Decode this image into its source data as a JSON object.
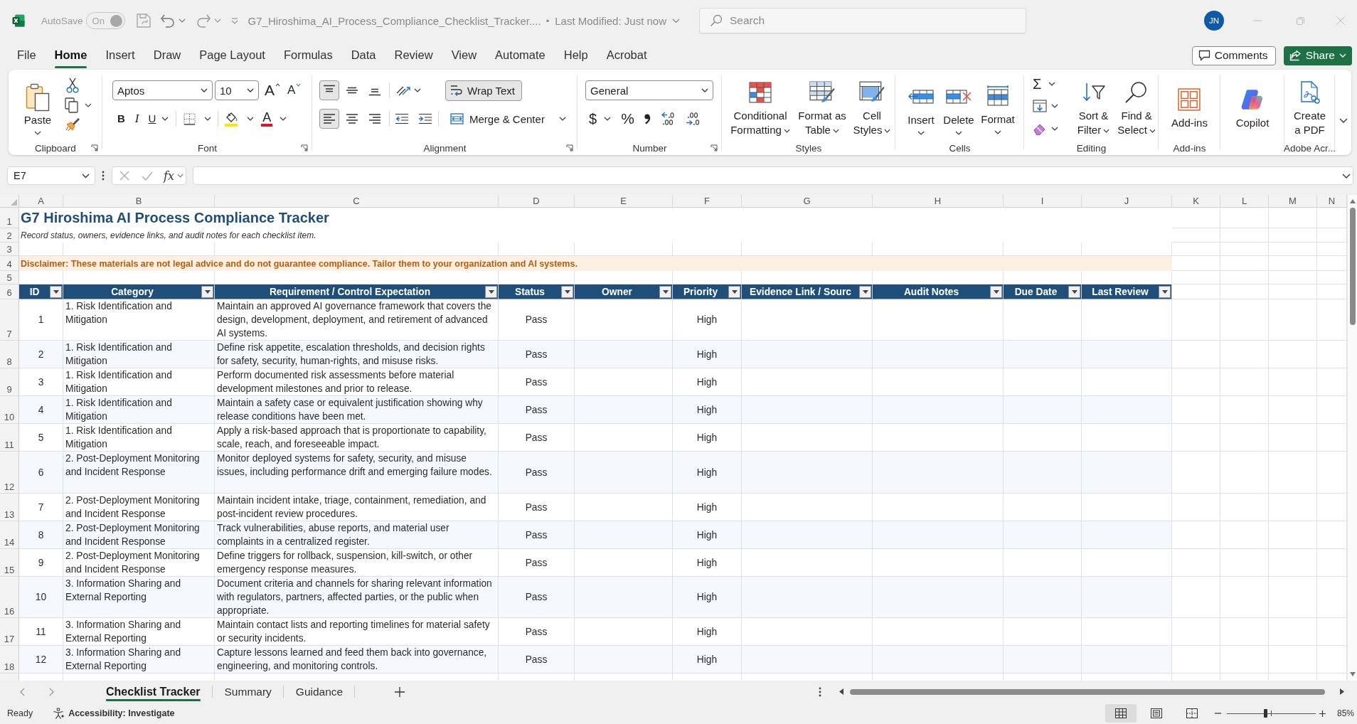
{
  "title_bar": {
    "autosave": {
      "label": "AutoSave",
      "toggle_text": "On",
      "on": true,
      "disabled": true
    },
    "document_title": "G7_Hiroshima_AI_Process_Compliance_Checklist_Tracker....",
    "separator": "•",
    "last_modified": "Last Modified: Just now",
    "search": {
      "placeholder": "Search"
    },
    "account_initials": "JN"
  },
  "menu_tabs": [
    {
      "label": "File",
      "selected": false
    },
    {
      "label": "Home",
      "selected": true
    },
    {
      "label": "Insert",
      "selected": false
    },
    {
      "label": "Draw",
      "selected": false
    },
    {
      "label": "Page Layout",
      "selected": false
    },
    {
      "label": "Formulas",
      "selected": false
    },
    {
      "label": "Data",
      "selected": false
    },
    {
      "label": "Review",
      "selected": false
    },
    {
      "label": "View",
      "selected": false
    },
    {
      "label": "Automate",
      "selected": false
    },
    {
      "label": "Help",
      "selected": false
    },
    {
      "label": "Acrobat",
      "selected": false
    }
  ],
  "comments_button": "Comments",
  "share_button": "Share",
  "ribbon": {
    "clipboard": {
      "label": "Clipboard",
      "paste": "Paste"
    },
    "font": {
      "label": "Font",
      "font_name": "Aptos",
      "font_size": "10",
      "grow": "A",
      "shrink": "A",
      "bold": "B",
      "italic": "I",
      "underline": "U",
      "font_color": "A"
    },
    "alignment": {
      "label": "Alignment",
      "vertical": [
        {
          "selected": true
        },
        {
          "selected": false
        },
        {
          "selected": false
        }
      ],
      "horizontal": [
        {
          "selected": true
        },
        {
          "selected": false
        },
        {
          "selected": false
        }
      ],
      "wrap_text": {
        "label": "Wrap Text",
        "on": true
      },
      "merge": "Merge & Center"
    },
    "number": {
      "label": "Number",
      "format": "General",
      "currency": "$",
      "percent": "%"
    },
    "styles": {
      "label": "Styles",
      "buttons": [
        {
          "label": "Conditional Formatting",
          "menu": true
        },
        {
          "label": "Format as Table",
          "menu": true
        },
        {
          "label": "Cell Styles",
          "menu": true
        }
      ]
    },
    "cells": {
      "label": "Cells",
      "buttons": [
        {
          "label": "Insert",
          "menu": true
        },
        {
          "label": "Delete",
          "menu": true
        },
        {
          "label": "Format",
          "menu": true
        }
      ]
    },
    "editing": {
      "label": "Editing",
      "autosum": "Σ",
      "buttons": [
        {
          "label": "Sort & Filter",
          "menu": true
        },
        {
          "label": "Find & Select",
          "menu": true
        }
      ]
    },
    "addins": {
      "label": "Add-ins",
      "button": "Add-ins"
    },
    "copilot": {
      "button": "Copilot"
    },
    "adobe": {
      "label": "Adobe Acr...",
      "button": "Create a PDF"
    }
  },
  "formula_bar": {
    "name_box": "E7",
    "function_label": "fx"
  },
  "column_headings": [
    "A",
    "B",
    "C",
    "D",
    "E",
    "F",
    "G",
    "H",
    "I",
    "J",
    "K",
    "L",
    "M",
    "N"
  ],
  "row_headings": [
    "1",
    "2",
    "3",
    "4",
    "5",
    "6",
    "7",
    "8",
    "9",
    "10",
    "11",
    "12",
    "13",
    "14",
    "15",
    "16",
    "17",
    "18"
  ],
  "sheet": {
    "title": "G7 Hiroshima AI Process Compliance Tracker",
    "subtitle": "Record status, owners, evidence links, and audit notes for each checklist item.",
    "disclaimer": "Disclaimer: These materials are not legal advice and do not guarantee compliance. Tailor them to your organization and AI systems."
  },
  "table": {
    "columns": [
      "ID",
      "Category",
      "Requirement / Control Expectation",
      "Status",
      "Owner",
      "Priority",
      "Evidence Link / Sourc",
      "Audit Notes",
      "Due Date",
      "Last Review"
    ],
    "rows": [
      {
        "id": "1",
        "category": "1. Risk Identification and Mitigation",
        "requirement": "Maintain an approved AI governance framework that covers the design, development, deployment, and retirement of advanced AI systems.",
        "status": "Pass",
        "priority": "High"
      },
      {
        "id": "2",
        "category": "1. Risk Identification and Mitigation",
        "requirement": "Define risk appetite, escalation thresholds, and decision rights for safety, security, human-rights, and misuse risks.",
        "status": "Pass",
        "priority": "High"
      },
      {
        "id": "3",
        "category": "1. Risk Identification and Mitigation",
        "requirement": "Perform documented risk assessments before material development milestones and prior to release.",
        "status": "Pass",
        "priority": "High"
      },
      {
        "id": "4",
        "category": "1. Risk Identification and Mitigation",
        "requirement": "Maintain a safety case or equivalent justification showing why release conditions have been met.",
        "status": "Pass",
        "priority": "High"
      },
      {
        "id": "5",
        "category": "1. Risk Identification and Mitigation",
        "requirement": "Apply a risk-based approach that is proportionate to capability, scale, reach, and foreseeable impact.",
        "status": "Pass",
        "priority": "High"
      },
      {
        "id": "6",
        "category": "2. Post-Deployment Monitoring and Incident Response",
        "requirement": "Monitor deployed systems for safety, security, and misuse issues, including performance drift and emerging failure modes.",
        "status": "Pass",
        "priority": "High"
      },
      {
        "id": "7",
        "category": "2. Post-Deployment Monitoring and Incident Response",
        "requirement": "Maintain incident intake, triage, containment, remediation, and post-incident review procedures.",
        "status": "Pass",
        "priority": "High"
      },
      {
        "id": "8",
        "category": "2. Post-Deployment Monitoring and Incident Response",
        "requirement": "Track vulnerabilities, abuse reports, and material user complaints in a centralized register.",
        "status": "Pass",
        "priority": "High"
      },
      {
        "id": "9",
        "category": "2. Post-Deployment Monitoring and Incident Response",
        "requirement": "Define triggers for rollback, suspension, kill-switch, or other emergency response measures.",
        "status": "Pass",
        "priority": "High"
      },
      {
        "id": "10",
        "category": "3. Information Sharing and External Reporting",
        "requirement": "Document criteria and channels for sharing relevant information with regulators, partners, affected parties, or the public when appropriate.",
        "status": "Pass",
        "priority": "High"
      },
      {
        "id": "11",
        "category": "3. Information Sharing and External Reporting",
        "requirement": "Maintain contact lists and reporting timelines for material safety or security incidents.",
        "status": "Pass",
        "priority": "High"
      },
      {
        "id": "12",
        "category": "3. Information Sharing and External Reporting",
        "requirement": "Capture lessons learned and feed them back into governance, engineering, and monitoring controls.",
        "status": "Pass",
        "priority": "High"
      }
    ]
  },
  "sheet_tabs": [
    {
      "label": "Checklist Tracker",
      "selected": true
    },
    {
      "label": "Summary",
      "selected": false
    },
    {
      "label": "Guidance",
      "selected": false
    }
  ],
  "status_bar": {
    "ready": "Ready",
    "accessibility": "Accessibility: Investigate",
    "views": [
      {
        "selected": true
      },
      {
        "selected": false
      },
      {
        "selected": false
      }
    ],
    "zoom_slider": {
      "level": 0.43
    },
    "zoom": "85%"
  }
}
